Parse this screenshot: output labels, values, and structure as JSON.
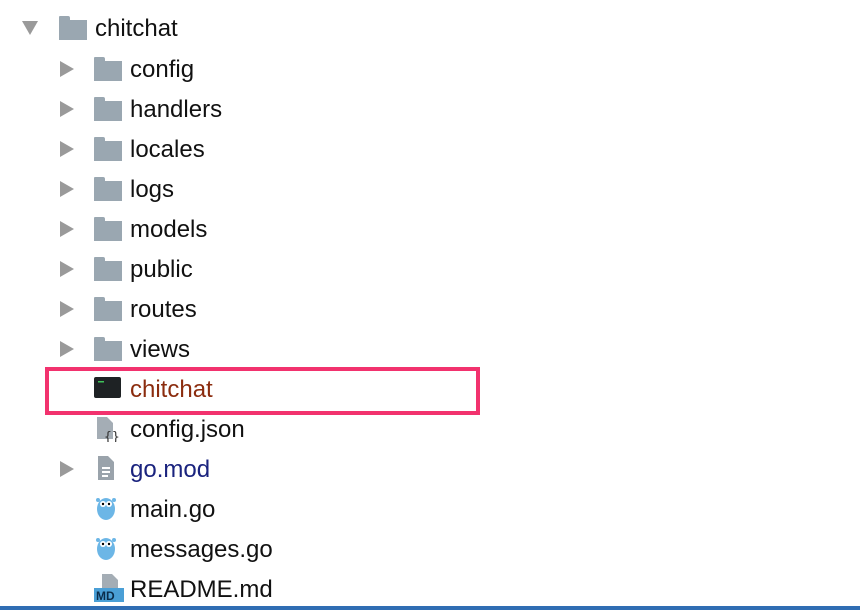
{
  "tree": {
    "root": {
      "label": "chitchat",
      "icon": "folder-icon",
      "expanded": true
    },
    "items": [
      {
        "label": "config",
        "type": "folder",
        "expandable": true
      },
      {
        "label": "handlers",
        "type": "folder",
        "expandable": true
      },
      {
        "label": "locales",
        "type": "folder",
        "expandable": true
      },
      {
        "label": "logs",
        "type": "folder",
        "expandable": true
      },
      {
        "label": "models",
        "type": "folder",
        "expandable": true
      },
      {
        "label": "public",
        "type": "folder",
        "expandable": true
      },
      {
        "label": "routes",
        "type": "folder",
        "expandable": true
      },
      {
        "label": "views",
        "type": "folder",
        "expandable": true
      },
      {
        "label": "chitchat",
        "type": "executable",
        "expandable": false,
        "highlighted": true,
        "color": "#8b2c0e"
      },
      {
        "label": "config.json",
        "type": "json",
        "expandable": false
      },
      {
        "label": "go.mod",
        "type": "gomod",
        "expandable": true,
        "color": "#1a237e"
      },
      {
        "label": "main.go",
        "type": "go",
        "expandable": false
      },
      {
        "label": "messages.go",
        "type": "go",
        "expandable": false
      },
      {
        "label": "README.md",
        "type": "markdown",
        "expandable": false,
        "badge": "MD"
      }
    ]
  },
  "colors": {
    "highlight": "#f2326e",
    "folder": "#9aa7b1",
    "selection_line": "#2f6db3"
  }
}
